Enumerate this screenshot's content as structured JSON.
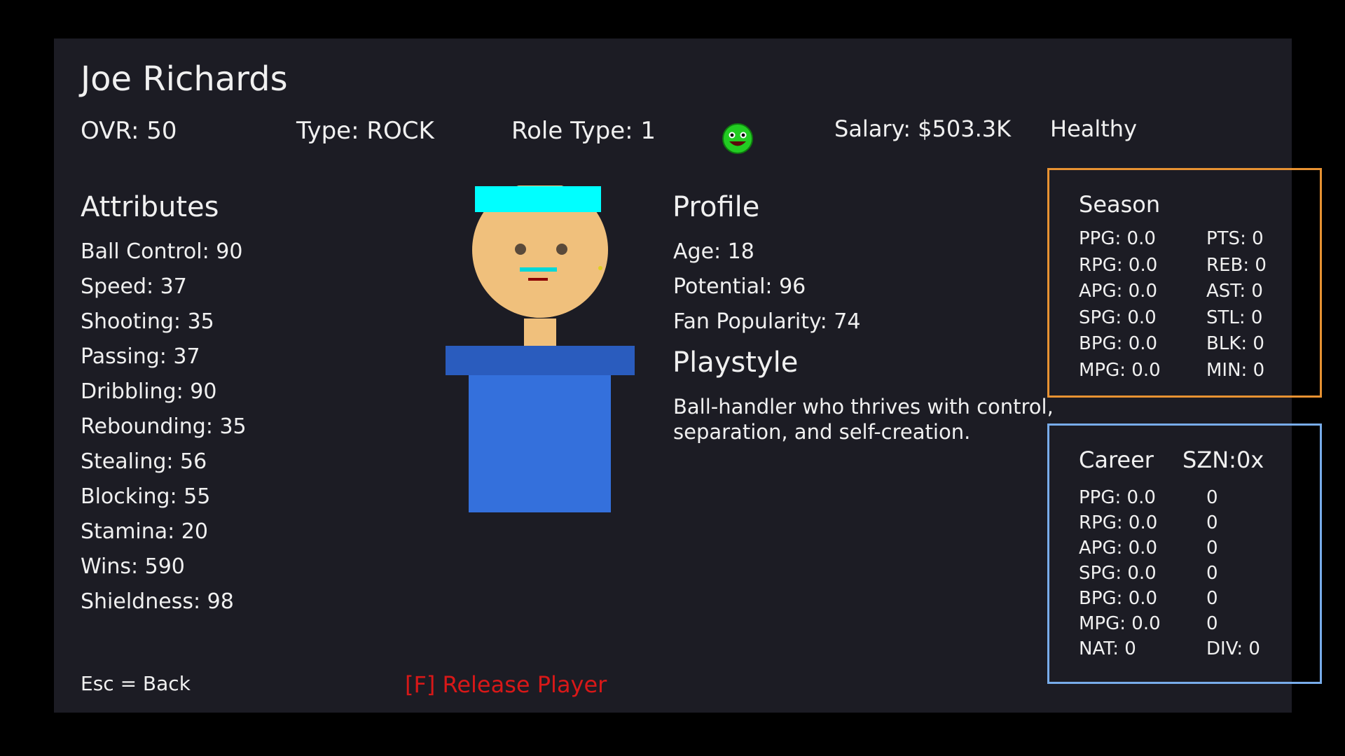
{
  "player": {
    "name": "Joe Richards",
    "ovr": "OVR: 50",
    "type": "Type: ROCK",
    "role_type": "Role Type: 1",
    "salary": "Salary: $503.3K",
    "health": "Healthy",
    "mood_icon": "happy-face-icon"
  },
  "attributes": {
    "title": "Attributes",
    "items": [
      "Ball Control: 90",
      "Speed: 37",
      "Shooting: 35",
      "Passing: 37",
      "Dribbling: 90",
      "Rebounding: 35",
      "Stealing: 56",
      "Blocking: 55",
      "Stamina: 20",
      "Wins: 590",
      "Shieldness: 98"
    ]
  },
  "profile": {
    "title": "Profile",
    "items": [
      "Age: 18",
      "Potential: 96",
      "Fan Popularity: 74"
    ],
    "playstyle_title": "Playstyle",
    "playstyle_text": "Ball-handler who thrives with control, separation, and self-creation."
  },
  "season": {
    "title": "Season",
    "rows": [
      [
        "PPG: 0.0",
        "PTS: 0"
      ],
      [
        "RPG: 0.0",
        "REB: 0"
      ],
      [
        "APG: 0.0",
        "AST: 0"
      ],
      [
        "SPG: 0.0",
        "STL: 0"
      ],
      [
        "BPG: 0.0",
        "BLK: 0"
      ],
      [
        "MPG: 0.0",
        "MIN: 0"
      ]
    ]
  },
  "career": {
    "title": "Career",
    "seasons_label": "SZN:0x",
    "rows": [
      [
        "PPG: 0.0",
        "0"
      ],
      [
        "RPG: 0.0",
        "0"
      ],
      [
        "APG: 0.0",
        "0"
      ],
      [
        "SPG: 0.0",
        "0"
      ],
      [
        "BPG: 0.0",
        "0"
      ],
      [
        "MPG: 0.0",
        "0"
      ],
      [
        "NAT: 0",
        "DIV: 0"
      ]
    ]
  },
  "footer": {
    "esc_hint": "Esc = Back",
    "release_label": "[F] Release Player"
  },
  "colors": {
    "panel_bg": "#1c1c24",
    "season_border": "#e89232",
    "career_border": "#78acea",
    "release_red": "#d81818",
    "avatar_headband": "#00ffff",
    "avatar_skin": "#f0c07c",
    "avatar_shirt": "#3470dc",
    "avatar_shoulders": "#2a5cbe"
  }
}
